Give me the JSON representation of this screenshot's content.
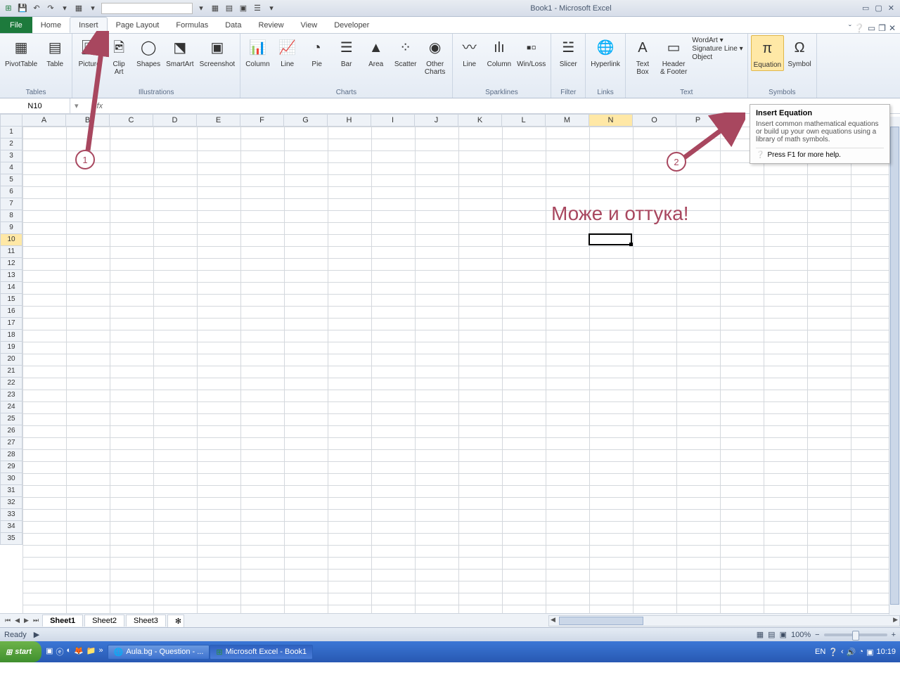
{
  "title": "Book1 - Microsoft Excel",
  "tabs": [
    "File",
    "Home",
    "Insert",
    "Page Layout",
    "Formulas",
    "Data",
    "Review",
    "View",
    "Developer"
  ],
  "activeTab": "Insert",
  "ribbon": {
    "groups": [
      {
        "label": "Tables",
        "buttons": [
          {
            "name": "PivotTable",
            "glyph": "▦"
          },
          {
            "name": "Table",
            "glyph": "▤"
          }
        ]
      },
      {
        "label": "Illustrations",
        "buttons": [
          {
            "name": "Picture",
            "glyph": "🖼"
          },
          {
            "name": "Clip\nArt",
            "glyph": "🖻"
          },
          {
            "name": "Shapes",
            "glyph": "◯"
          },
          {
            "name": "SmartArt",
            "glyph": "⬔"
          },
          {
            "name": "Screenshot",
            "glyph": "▣"
          }
        ]
      },
      {
        "label": "Charts",
        "buttons": [
          {
            "name": "Column",
            "glyph": "📊"
          },
          {
            "name": "Line",
            "glyph": "📈"
          },
          {
            "name": "Pie",
            "glyph": "◔"
          },
          {
            "name": "Bar",
            "glyph": "☰"
          },
          {
            "name": "Area",
            "glyph": "▲"
          },
          {
            "name": "Scatter",
            "glyph": "⁘"
          },
          {
            "name": "Other\nCharts",
            "glyph": "◉"
          }
        ]
      },
      {
        "label": "Sparklines",
        "buttons": [
          {
            "name": "Line",
            "glyph": "〰"
          },
          {
            "name": "Column",
            "glyph": "ılı"
          },
          {
            "name": "Win/Loss",
            "glyph": "▪▫"
          }
        ]
      },
      {
        "label": "Filter",
        "buttons": [
          {
            "name": "Slicer",
            "glyph": "☱"
          }
        ]
      },
      {
        "label": "Links",
        "buttons": [
          {
            "name": "Hyperlink",
            "glyph": "🌐"
          }
        ]
      },
      {
        "label": "Text",
        "buttons": [
          {
            "name": "Text\nBox",
            "glyph": "A"
          },
          {
            "name": "Header\n& Footer",
            "glyph": "▭"
          }
        ],
        "stack": [
          "WordArt ▾",
          "Signature Line ▾",
          "Object"
        ]
      },
      {
        "label": "Symbols",
        "buttons": [
          {
            "name": "Equation",
            "glyph": "π",
            "sel": true
          },
          {
            "name": "Symbol",
            "glyph": "Ω"
          }
        ]
      }
    ]
  },
  "namebox": "N10",
  "columns": [
    "A",
    "B",
    "C",
    "D",
    "E",
    "F",
    "G",
    "H",
    "I",
    "J",
    "K",
    "L",
    "M",
    "N",
    "O",
    "P"
  ],
  "selCol": "N",
  "selRow": 10,
  "rowCount": 35,
  "tooltip": {
    "title": "Insert Equation",
    "body": "Insert common mathematical equations or build up your own equations using a library of math symbols.",
    "help": "Press F1 for more help."
  },
  "annotText": "Може и оттука!",
  "annot1": "1",
  "annot2": "2",
  "sheets": [
    "Sheet1",
    "Sheet2",
    "Sheet3"
  ],
  "status": "Ready",
  "zoom": "100%",
  "taskbar": {
    "start": "start",
    "btn1": "Aula.bg - Question - ...",
    "btn2": "Microsoft Excel - Book1",
    "time": "10:19"
  }
}
